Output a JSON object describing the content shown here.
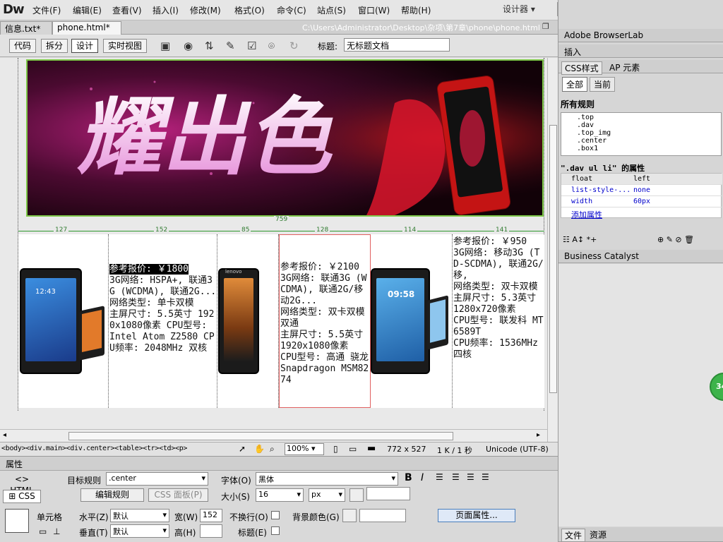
{
  "app": {
    "logo": "Dw"
  },
  "menu": [
    "文件(F)",
    "编辑(E)",
    "查看(V)",
    "插入(I)",
    "修改(M)",
    "格式(O)",
    "命令(C)",
    "站点(S)",
    "窗口(W)",
    "帮助(H)"
  ],
  "workspace": "设计器",
  "window_controls": {
    "minimize": "–",
    "restore": "❐",
    "close": "✕"
  },
  "tabs": [
    {
      "label": "信息.txt*",
      "close": "×"
    },
    {
      "label": "phone.html*",
      "close": "×"
    }
  ],
  "filepath": "C:\\Users\\Administrator\\Desktop\\杂项\\第7章\\phone\\phone.html",
  "view_buttons": [
    "代码",
    "拆分",
    "设计",
    "实时视图"
  ],
  "title_label": "标题:",
  "doc_title": "无标题文档",
  "banner_text": "耀出色",
  "ruler": {
    "total": "759",
    "cols": [
      "127",
      "152",
      "85",
      "128",
      "114",
      "141"
    ]
  },
  "products": [
    {
      "price": "参考报价: ￥1800",
      "lines": [
        "3G网络: HSPA+, 联通3G (WCDMA), 联通2G...",
        "网络类型: 单卡双模",
        "主屏尺寸: 5.5英寸 1920x1080像素 CPU型号: Intel Atom Z2580 CPU频率: 2048MHz 双核"
      ]
    },
    {
      "price": "参考报价: ￥2100",
      "lines": [
        "3G网络: 联通3G (WCDMA), 联通2G/移动2G...",
        "网络类型: 双卡双模双通",
        "主屏尺寸: 5.5英寸 1920x1080像素",
        "CPU型号: 高通 骁龙Snapdragon MSM8274"
      ]
    },
    {
      "price": "参考报价: ￥950",
      "lines": [
        "3G网络: 移动3G (TD-SCDMA), 联通2G/移,",
        "网络类型: 双卡双模",
        "主屏尺寸: 5.3英寸 1280x720像素",
        "CPU型号: 联发科 MT6589T",
        "CPU频率: 1536MHz 四核"
      ]
    }
  ],
  "phone_screen_times": [
    "12:43",
    "09:58"
  ],
  "phone_brand": "lenovo",
  "statusbar": {
    "tags": "<body><div.main><div.center><table><tr><td><p>",
    "zoom": "100%",
    "dims": "772 x 527",
    "size": "1 K / 1 秒",
    "encoding": "Unicode (UTF-8)"
  },
  "properties": {
    "header": "属性",
    "html_btn": "HTML",
    "css_btn": "CSS",
    "target_rule_label": "目标规则",
    "target_rule": ".center",
    "edit_rule": "编辑规则",
    "css_panel": "CSS 面板(P)",
    "font_label": "字体(O)",
    "font_value": "黑体",
    "size_label": "大小(S)",
    "size_value": "16",
    "size_unit": "px",
    "cell_label": "单元格",
    "horz_label": "水平(Z)",
    "horz_value": "默认",
    "vert_label": "垂直(T)",
    "vert_value": "默认",
    "width_label": "宽(W)",
    "width_value": "152",
    "height_label": "高(H)",
    "nowrap_label": "不换行(O)",
    "header_label": "标题(E)",
    "bg_label": "背景颜色(G)",
    "page_props": "页面属性..."
  },
  "panel": {
    "browserlab": "Adobe BrowserLab",
    "insert": "插入",
    "css_tab": "CSS样式",
    "ap_tab": "AP 元素",
    "all_btn": "全部",
    "current_btn": "当前",
    "all_rules": "所有规则",
    "rules": [
      ".top",
      ".dav",
      ".top_img",
      ".center",
      ".box1"
    ],
    "props_title": "\".dav ul li\" 的属性",
    "props": [
      {
        "k": "float",
        "v": "left"
      },
      {
        "k": "list-style-...",
        "v": "none"
      },
      {
        "k": "width",
        "v": "60px"
      }
    ],
    "add_prop": "添加属性",
    "business_catalyst": "Business Catalyst",
    "files_tab": "文件",
    "assets_tab": "资源"
  },
  "badge": "34"
}
